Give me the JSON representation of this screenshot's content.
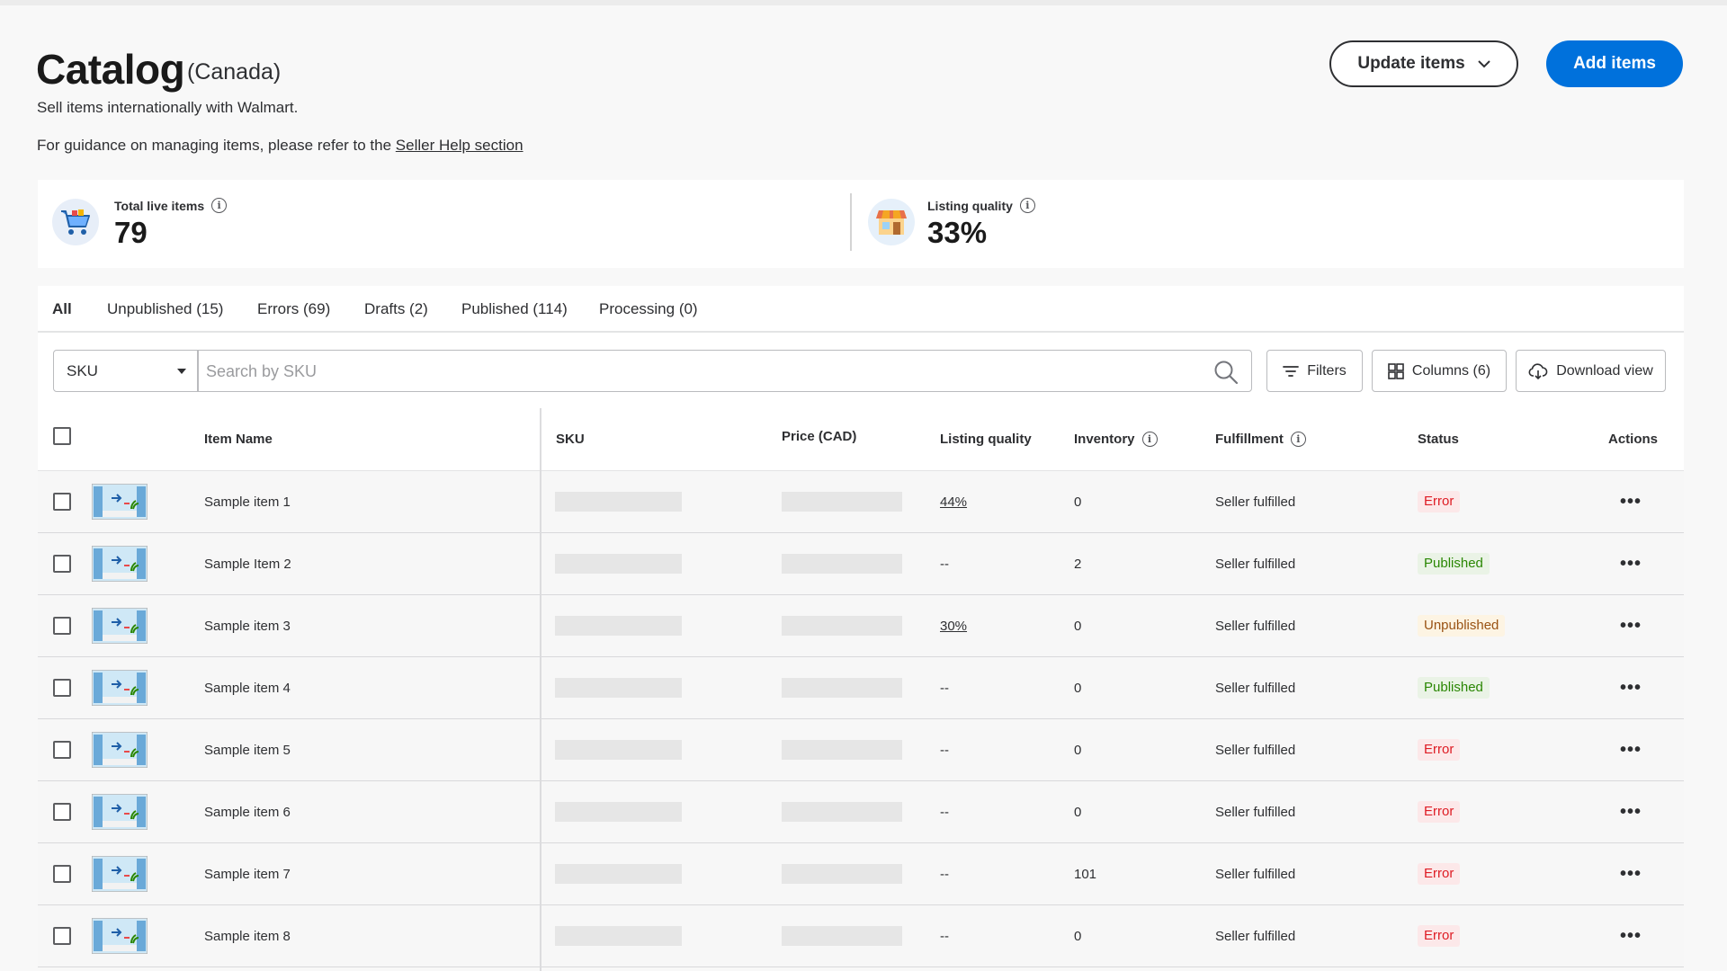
{
  "header": {
    "title": "Catalog",
    "region": "(Canada)",
    "subtitle": "Sell items internationally with Walmart.",
    "guidance_prefix": "For guidance on managing items, please refer to the ",
    "guidance_link": "Seller Help section",
    "update_items_label": "Update items",
    "add_items_label": "Add items"
  },
  "stats": {
    "total_live": {
      "label": "Total live items",
      "value": "79",
      "icon": "shopping-cart-icon"
    },
    "listing_quality": {
      "label": "Listing quality",
      "value": "33%",
      "icon": "storefront-icon"
    }
  },
  "tabs": [
    {
      "label": "All",
      "active": true
    },
    {
      "label": "Unpublished (15)",
      "active": false
    },
    {
      "label": "Errors (69)",
      "active": false
    },
    {
      "label": "Drafts (2)",
      "active": false
    },
    {
      "label": "Published (114)",
      "active": false
    },
    {
      "label": "Processing (0)",
      "active": false
    }
  ],
  "toolbar": {
    "search_field_selected": "SKU",
    "search_placeholder": "Search by SKU",
    "filters_label": "Filters",
    "columns_label": "Columns (6)",
    "download_label": "Download view"
  },
  "table": {
    "headers": {
      "item_name": "Item Name",
      "sku": "SKU",
      "price": "Price (CAD)",
      "listing_quality": "Listing quality",
      "inventory": "Inventory",
      "fulfillment": "Fulfillment",
      "status": "Status",
      "actions": "Actions"
    },
    "actions_glyph": "•••",
    "rows": [
      {
        "name": "Sample item 1",
        "listing_quality": "44%",
        "quality_link": true,
        "inventory": "0",
        "fulfillment": "Seller fulfilled",
        "status": "Error",
        "status_type": "error"
      },
      {
        "name": "Sample Item 2",
        "listing_quality": "--",
        "quality_link": false,
        "inventory": "2",
        "fulfillment": "Seller fulfilled",
        "status": "Published",
        "status_type": "published"
      },
      {
        "name": "Sample item 3",
        "listing_quality": "30%",
        "quality_link": true,
        "inventory": "0",
        "fulfillment": "Seller fulfilled",
        "status": "Unpublished",
        "status_type": "unpublished"
      },
      {
        "name": "Sample item 4",
        "listing_quality": "--",
        "quality_link": false,
        "inventory": "0",
        "fulfillment": "Seller fulfilled",
        "status": "Published",
        "status_type": "published"
      },
      {
        "name": "Sample item 5",
        "listing_quality": "--",
        "quality_link": false,
        "inventory": "0",
        "fulfillment": "Seller fulfilled",
        "status": "Error",
        "status_type": "error"
      },
      {
        "name": "Sample item 6",
        "listing_quality": "--",
        "quality_link": false,
        "inventory": "0",
        "fulfillment": "Seller fulfilled",
        "status": "Error",
        "status_type": "error"
      },
      {
        "name": "Sample item 7",
        "listing_quality": "--",
        "quality_link": false,
        "inventory": "101",
        "fulfillment": "Seller fulfilled",
        "status": "Error",
        "status_type": "error"
      },
      {
        "name": "Sample item 8",
        "listing_quality": "--",
        "quality_link": false,
        "inventory": "0",
        "fulfillment": "Seller fulfilled",
        "status": "Error",
        "status_type": "error"
      }
    ]
  },
  "colors": {
    "primary": "#0071dc",
    "error_text": "#de1c24",
    "published_text": "#2a8703",
    "unpublished_text": "#995213"
  }
}
